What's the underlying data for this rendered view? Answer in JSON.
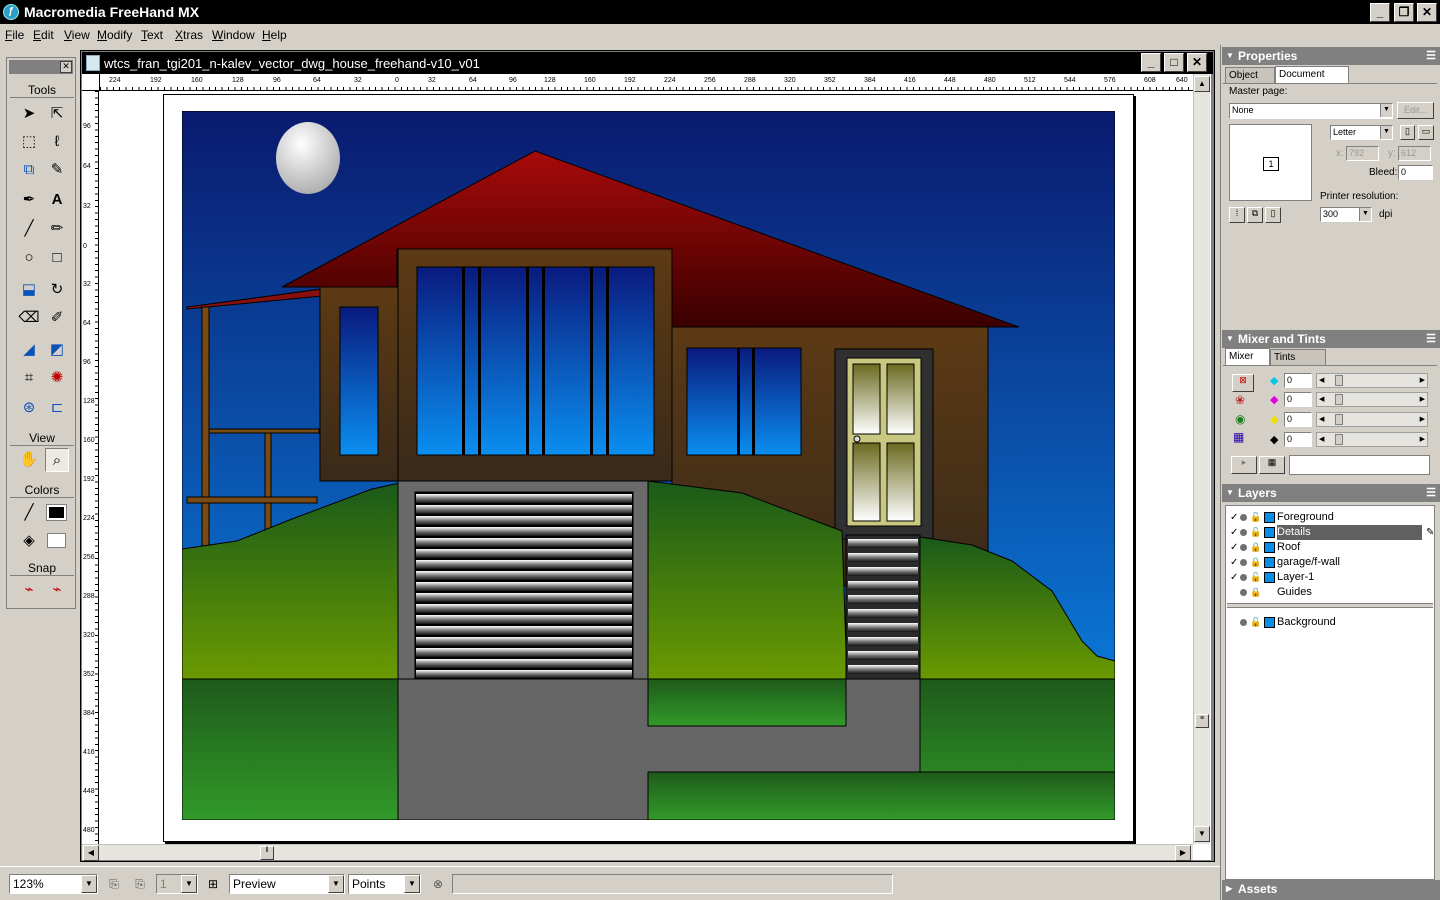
{
  "app": {
    "title": "Macromedia FreeHand MX"
  },
  "menu": [
    "File",
    "Edit",
    "View",
    "Modify",
    "Text",
    "Xtras",
    "Window",
    "Help"
  ],
  "toolbox": {
    "sections": [
      "Tools",
      "View",
      "Colors",
      "Snap"
    ]
  },
  "document": {
    "title": "wtcs_fran_tgi201_n-kalev_vector_dwg_house_freehand-v10_v01",
    "ruler_top_labels": [
      "224",
      "192",
      "160",
      "128",
      "96",
      "64",
      "32",
      "0",
      "32",
      "64",
      "96",
      "128",
      "160",
      "192",
      "224",
      "256",
      "288",
      "320",
      "352",
      "384",
      "416",
      "448",
      "480",
      "512",
      "544",
      "576",
      "608",
      "640"
    ],
    "ruler_left_labels": [
      "96",
      "64",
      "32",
      "0",
      "32",
      "64",
      "96",
      "128",
      "160",
      "192",
      "224",
      "256",
      "288",
      "320",
      "352",
      "384",
      "416",
      "448",
      "480"
    ]
  },
  "statusbar": {
    "zoom": "123%",
    "page_number": "1",
    "view_mode": "Preview",
    "units": "Points"
  },
  "properties_panel": {
    "title": "Properties",
    "tabs": [
      "Object",
      "Document"
    ],
    "active_tab": "Document",
    "master_page_label": "Master page:",
    "master_page_value": "None",
    "edit_button": "Edit...",
    "page_thumb_number": "1",
    "page_size": "Letter",
    "x_label": "x:",
    "x_value": "792",
    "y_label": "y:",
    "y_value": "612",
    "bleed_label": "Bleed:",
    "bleed_value": "0",
    "printer_resolution_label": "Printer resolution:",
    "printer_resolution_value": "300",
    "dpi_label": "dpi"
  },
  "mixer_panel": {
    "title": "Mixer and Tints",
    "tabs": [
      "Mixer",
      "Tints"
    ],
    "active_tab": "Mixer",
    "channels": [
      {
        "name": "cyan",
        "value": "0",
        "color": "#00c8e8"
      },
      {
        "name": "magenta",
        "value": "0",
        "color": "#e000e0"
      },
      {
        "name": "yellow",
        "value": "0",
        "color": "#f0e000"
      },
      {
        "name": "black",
        "value": "0",
        "color": "#000000"
      }
    ]
  },
  "layers_panel": {
    "title": "Layers",
    "layers": [
      {
        "name": "Foreground",
        "checked": true,
        "selected": false
      },
      {
        "name": "Details",
        "checked": true,
        "selected": true
      },
      {
        "name": "Roof",
        "checked": true,
        "selected": false
      },
      {
        "name": "garage/f-wall",
        "checked": true,
        "selected": false
      },
      {
        "name": "Layer-1",
        "checked": true,
        "selected": false
      },
      {
        "name": "Guides",
        "checked": false,
        "selected": false
      }
    ],
    "background_layer": "Background",
    "layer_color": "#0a8ee8"
  },
  "assets_panel": {
    "title": "Assets"
  },
  "colors": {
    "sky_top": "#0a1a6e",
    "sky_bottom": "#0a8ff0",
    "roof": "#8a0a0a",
    "wall": "#5a3a1a",
    "grass_light": "#6a9a00",
    "grass_dark": "#1a5a1a",
    "drive": "#666666"
  }
}
